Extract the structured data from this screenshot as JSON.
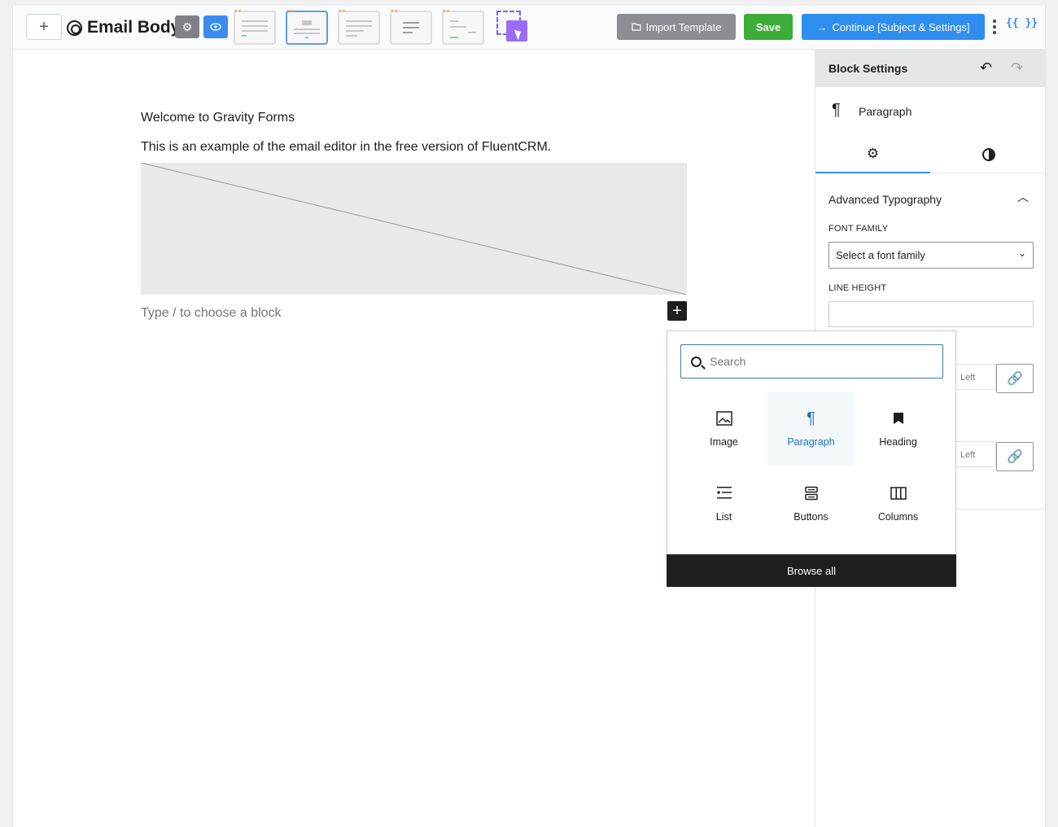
{
  "toolbar": {
    "add_label": "+",
    "title": "Email Body",
    "import_label": "Import Template",
    "save_label": "Save",
    "continue_label": "Continue [Subject & Settings]",
    "shortcodes_label": "{{ }}"
  },
  "canvas": {
    "welcome_text": "Welcome to Gravity Forms",
    "example_text": "This is an example of the email editor in the free version of FluentCRM.",
    "appender_placeholder": "Type / to choose a block",
    "inserter_label": "+"
  },
  "sidebar": {
    "title": "Block Settings",
    "block_name": "Paragraph",
    "panel_title": "Advanced Typography",
    "font_family_label": "FONT FAMILY",
    "font_family_value": "Select a font family",
    "line_height_label": "LINE HEIGHT",
    "spacing_left_1": "Left",
    "spacing_left_2": "Left"
  },
  "inserter": {
    "search_placeholder": "Search",
    "blocks": [
      {
        "label": "Image",
        "icon": "image-icon"
      },
      {
        "label": "Paragraph",
        "icon": "paragraph-icon",
        "highlighted": true
      },
      {
        "label": "Heading",
        "icon": "bookmark-icon"
      },
      {
        "label": "List",
        "icon": "list-icon"
      },
      {
        "label": "Buttons",
        "icon": "buttons-icon"
      },
      {
        "label": "Columns",
        "icon": "columns-icon"
      }
    ],
    "browse_all_label": "Browse all"
  },
  "colors": {
    "accent_blue": "#2f8fef",
    "save_green": "#3dad3a",
    "import_gray": "#8b8e93",
    "inserter_dark": "#1e1e1e"
  }
}
